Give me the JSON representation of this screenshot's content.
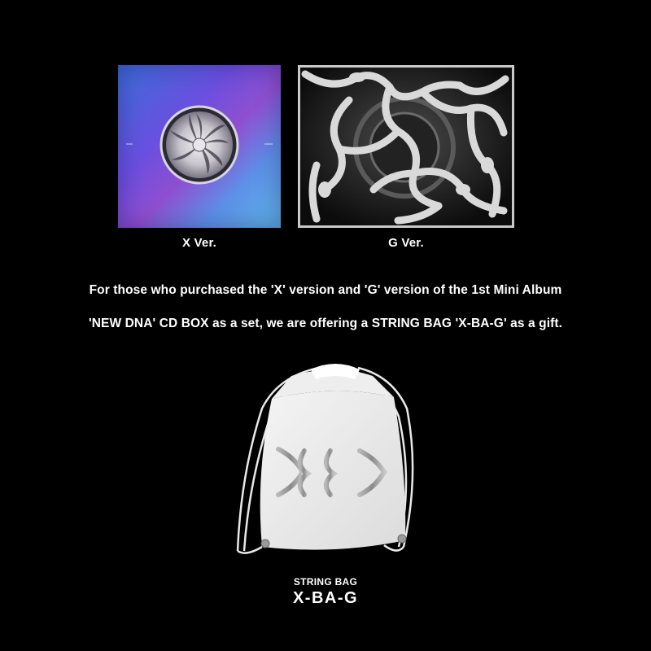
{
  "albums": [
    {
      "caption": "X Ver."
    },
    {
      "caption": "G Ver."
    }
  ],
  "description": {
    "line1": "For those who purchased the 'X' version and 'G' version of the 1st Mini Album",
    "line2": "'NEW DNA' CD BOX as a set, we are offering a STRING BAG 'X-BA-G' as a gift."
  },
  "gift": {
    "label": "STRING BAG",
    "name": "X-BA-G"
  },
  "colors": {
    "background": "#000000",
    "text": "#ffffff",
    "g_frame": "#c9c9c9"
  }
}
